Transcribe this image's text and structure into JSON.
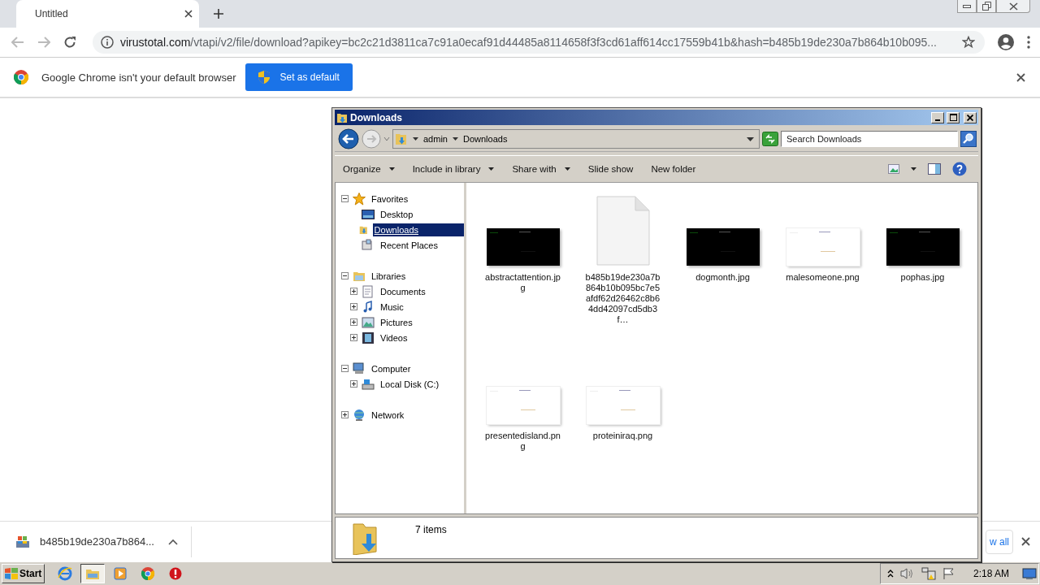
{
  "browser": {
    "tab": {
      "title": "Untitled"
    },
    "url": {
      "host": "virustotal.com",
      "path": "/vtapi/v2/file/download?apikey=bc2c21d3811ca7c91a0ecaf91d44485a8114658f3f3cd61aff614cc17559b41b&hash=b485b19de230a7b864b10b095..."
    },
    "infobar": {
      "message": "Google Chrome isn't your default browser",
      "button": "Set as default"
    },
    "download_shelf": {
      "file": "b485b19de230a7b864...",
      "show_all": "w all"
    }
  },
  "explorer": {
    "title": "Downloads",
    "breadcrumb": [
      "admin",
      "Downloads"
    ],
    "search": {
      "placeholder": "Search Downloads"
    },
    "toolbar": [
      {
        "label": "Organize",
        "dropdown": true
      },
      {
        "label": "Include in library",
        "dropdown": true
      },
      {
        "label": "Share with",
        "dropdown": true
      },
      {
        "label": "Slide show",
        "dropdown": false
      },
      {
        "label": "New folder",
        "dropdown": false
      }
    ],
    "nav": [
      {
        "label": "Favorites",
        "kind": "star",
        "expanded": true,
        "children": [
          {
            "label": "Desktop",
            "kind": "desktop",
            "selected": false
          },
          {
            "label": "Downloads",
            "kind": "downloads",
            "selected": true
          },
          {
            "label": "Recent Places",
            "kind": "recent",
            "selected": false
          }
        ]
      },
      {
        "label": "Libraries",
        "kind": "library",
        "expanded": true,
        "children": [
          {
            "label": "Documents",
            "kind": "documents",
            "expanded": false,
            "selected": false
          },
          {
            "label": "Music",
            "kind": "music",
            "expanded": false,
            "selected": false
          },
          {
            "label": "Pictures",
            "kind": "pictures",
            "expanded": false,
            "selected": false
          },
          {
            "label": "Videos",
            "kind": "videos",
            "expanded": false,
            "selected": false
          }
        ]
      },
      {
        "label": "Computer",
        "kind": "computer",
        "expanded": true,
        "children": [
          {
            "label": "Local Disk (C:)",
            "kind": "disk",
            "expanded": false,
            "selected": false
          }
        ]
      },
      {
        "label": "Network",
        "kind": "network",
        "expanded": false
      }
    ],
    "files": [
      {
        "name": "abstractattention.jpg",
        "kind": "dark"
      },
      {
        "name": "b485b19de230a7b864b10b095bc7e5afdf62d26462c8b64dd42097cd5db3f…",
        "kind": "document"
      },
      {
        "name": "dogmonth.jpg",
        "kind": "dark"
      },
      {
        "name": "malesomeone.png",
        "kind": "light"
      },
      {
        "name": "pophas.jpg",
        "kind": "dark"
      },
      {
        "name": "presentedisland.png",
        "kind": "light"
      },
      {
        "name": "proteiniraq.png",
        "kind": "light"
      }
    ],
    "status": "7 items"
  },
  "taskbar": {
    "start": "Start",
    "apps": [
      {
        "kind": "ie",
        "selected": false
      },
      {
        "kind": "explorer",
        "selected": true
      },
      {
        "kind": "media",
        "selected": false
      },
      {
        "kind": "chrome",
        "selected": false
      },
      {
        "kind": "stop",
        "selected": false
      }
    ],
    "clock": "2:18 AM"
  }
}
